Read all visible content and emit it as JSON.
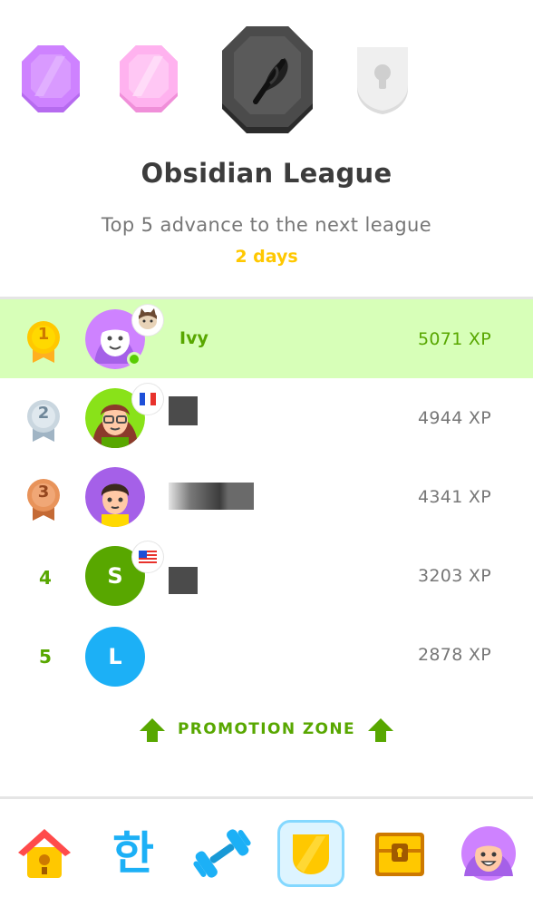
{
  "league": {
    "title": "Obsidian League",
    "subtitle": "Top 5 advance to the next league",
    "time_left": "2 days",
    "badges": [
      {
        "name": "amethyst",
        "icon": "amethyst-badge-icon",
        "color": "#ce82ff",
        "state": "completed"
      },
      {
        "name": "pearl",
        "icon": "pearl-badge-icon",
        "color": "#ffb2ef",
        "state": "completed"
      },
      {
        "name": "obsidian",
        "icon": "obsidian-badge-icon",
        "color": "#4b4b4b",
        "state": "current"
      },
      {
        "name": "diamond",
        "icon": "locked-badge-icon",
        "color": "#e5e5e5",
        "state": "locked"
      }
    ]
  },
  "leaderboard": [
    {
      "rank": "1",
      "name": "Ivy",
      "xp": "5071 XP",
      "highlight": true,
      "medal": "gold-medal-icon",
      "avatar": "ivy-avatar",
      "flag": "cat-emoji-icon",
      "online": true
    },
    {
      "rank": "2",
      "name": "",
      "xp": "4944 XP",
      "highlight": false,
      "medal": "silver-medal-icon",
      "avatar": "user2-avatar",
      "flag": "france-flag-icon",
      "online": false
    },
    {
      "rank": "3",
      "name": "",
      "xp": "4341 XP",
      "highlight": false,
      "medal": "bronze-medal-icon",
      "avatar": "user3-avatar",
      "flag": "",
      "online": false
    },
    {
      "rank": "4",
      "name": "",
      "xp": "3203 XP",
      "highlight": false,
      "initial": "S",
      "avatar_color": "#58a700",
      "flag": "usa-flag-icon",
      "online": false
    },
    {
      "rank": "5",
      "name": "",
      "xp": "2878 XP",
      "highlight": false,
      "initial": "L",
      "avatar_color": "#1cb0f6",
      "flag": "",
      "online": false
    }
  ],
  "promotion_zone": {
    "label": "PROMOTION ZONE",
    "icon": "up-arrow-icon",
    "color": "#58a700"
  },
  "nav": [
    {
      "name": "home",
      "icon": "birdhouse-icon"
    },
    {
      "name": "characters",
      "icon": "hangul-han-icon",
      "glyph": "한"
    },
    {
      "name": "practice",
      "icon": "dumbbell-icon"
    },
    {
      "name": "leagues",
      "icon": "shield-icon",
      "active": true
    },
    {
      "name": "shop",
      "icon": "treasure-chest-icon"
    },
    {
      "name": "profile",
      "icon": "profile-avatar-icon"
    }
  ]
}
